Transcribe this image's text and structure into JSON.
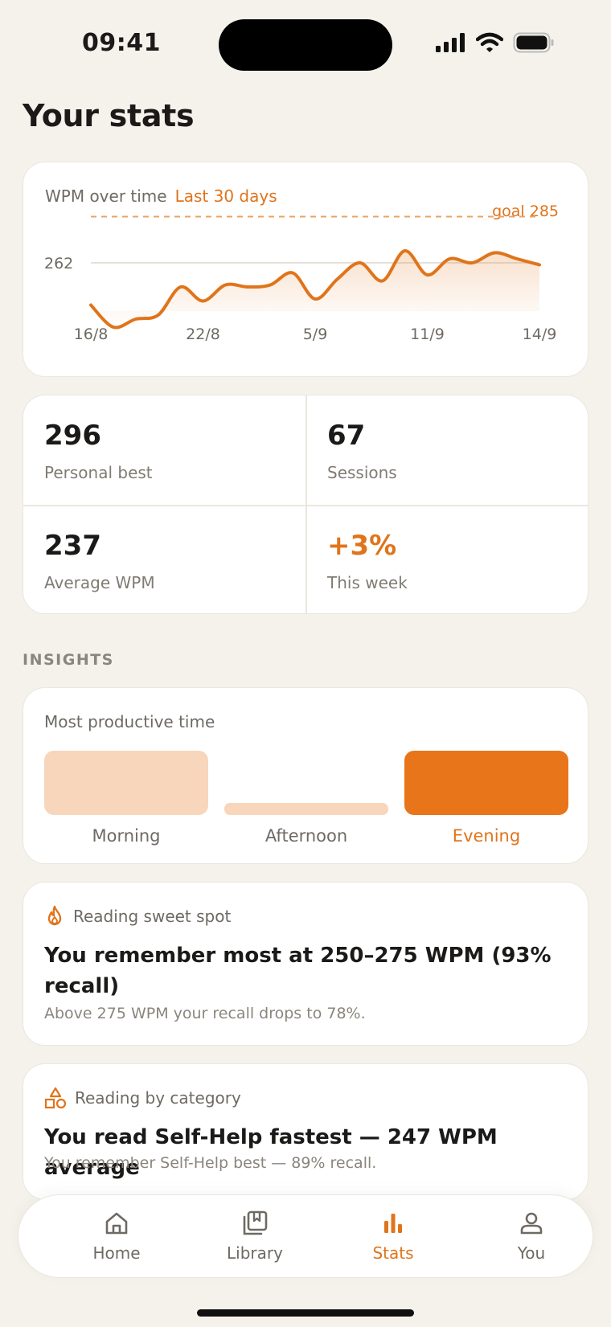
{
  "status": {
    "time": "09:41"
  },
  "page": {
    "title": "Your stats"
  },
  "chart_data": {
    "type": "line",
    "title": "WPM over time",
    "range_label": "Last 30 days",
    "x_tick_labels": [
      "16/8",
      "22/8",
      "5/9",
      "11/9",
      "14/9"
    ],
    "y_tick_labels": [
      "262"
    ],
    "goal_label": "goal 285",
    "goal": 285,
    "reference": 262,
    "ylim": [
      220,
      300
    ],
    "x": [
      0,
      1,
      2,
      3,
      4,
      5,
      6,
      7,
      8,
      9,
      10,
      11,
      12,
      13,
      14,
      15,
      16,
      17,
      18,
      19,
      20
    ],
    "values": [
      241,
      230,
      234,
      236,
      250,
      243,
      251,
      250,
      251,
      257,
      244,
      254,
      262,
      253,
      268,
      256,
      264,
      262,
      267,
      264,
      261
    ],
    "color": "#e0741b",
    "grid": false
  },
  "stats": [
    {
      "value": "296",
      "label": "Personal best"
    },
    {
      "value": "67",
      "label": "Sessions"
    },
    {
      "value": "237",
      "label": "Average WPM"
    },
    {
      "value": "+3%",
      "label": "This week"
    }
  ],
  "insights": {
    "section_label": "INSIGHTS",
    "productive": {
      "title": "Most productive time",
      "bars": [
        {
          "label": "Morning",
          "level": 0.8
        },
        {
          "label": "Afternoon",
          "level": 0.15
        },
        {
          "label": "Evening",
          "level": 0.8
        }
      ],
      "active": "Evening",
      "colors": {
        "light": "#f8d6bb",
        "active": "#e8751a"
      }
    },
    "sweet_spot": {
      "heading": "Reading sweet spot",
      "main": "You remember most at 250–275 WPM (93% recall)",
      "sub": "Above 275 WPM your recall drops to 78%.",
      "icon": "flame-icon"
    },
    "category": {
      "heading": "Reading by category",
      "main": "You read Self-Help fastest — 247 WPM average",
      "sub": "You remember Self-Help best — 89% recall.",
      "icon": "shapes-icon"
    }
  },
  "tabs": [
    {
      "label": "Home",
      "icon": "home-icon"
    },
    {
      "label": "Library",
      "icon": "library-icon"
    },
    {
      "label": "Stats",
      "icon": "stats-icon",
      "active": true
    },
    {
      "label": "You",
      "icon": "person-icon"
    }
  ],
  "colors": {
    "accent": "#e0741b",
    "background": "#f5f2ec",
    "card": "#ffffff"
  }
}
